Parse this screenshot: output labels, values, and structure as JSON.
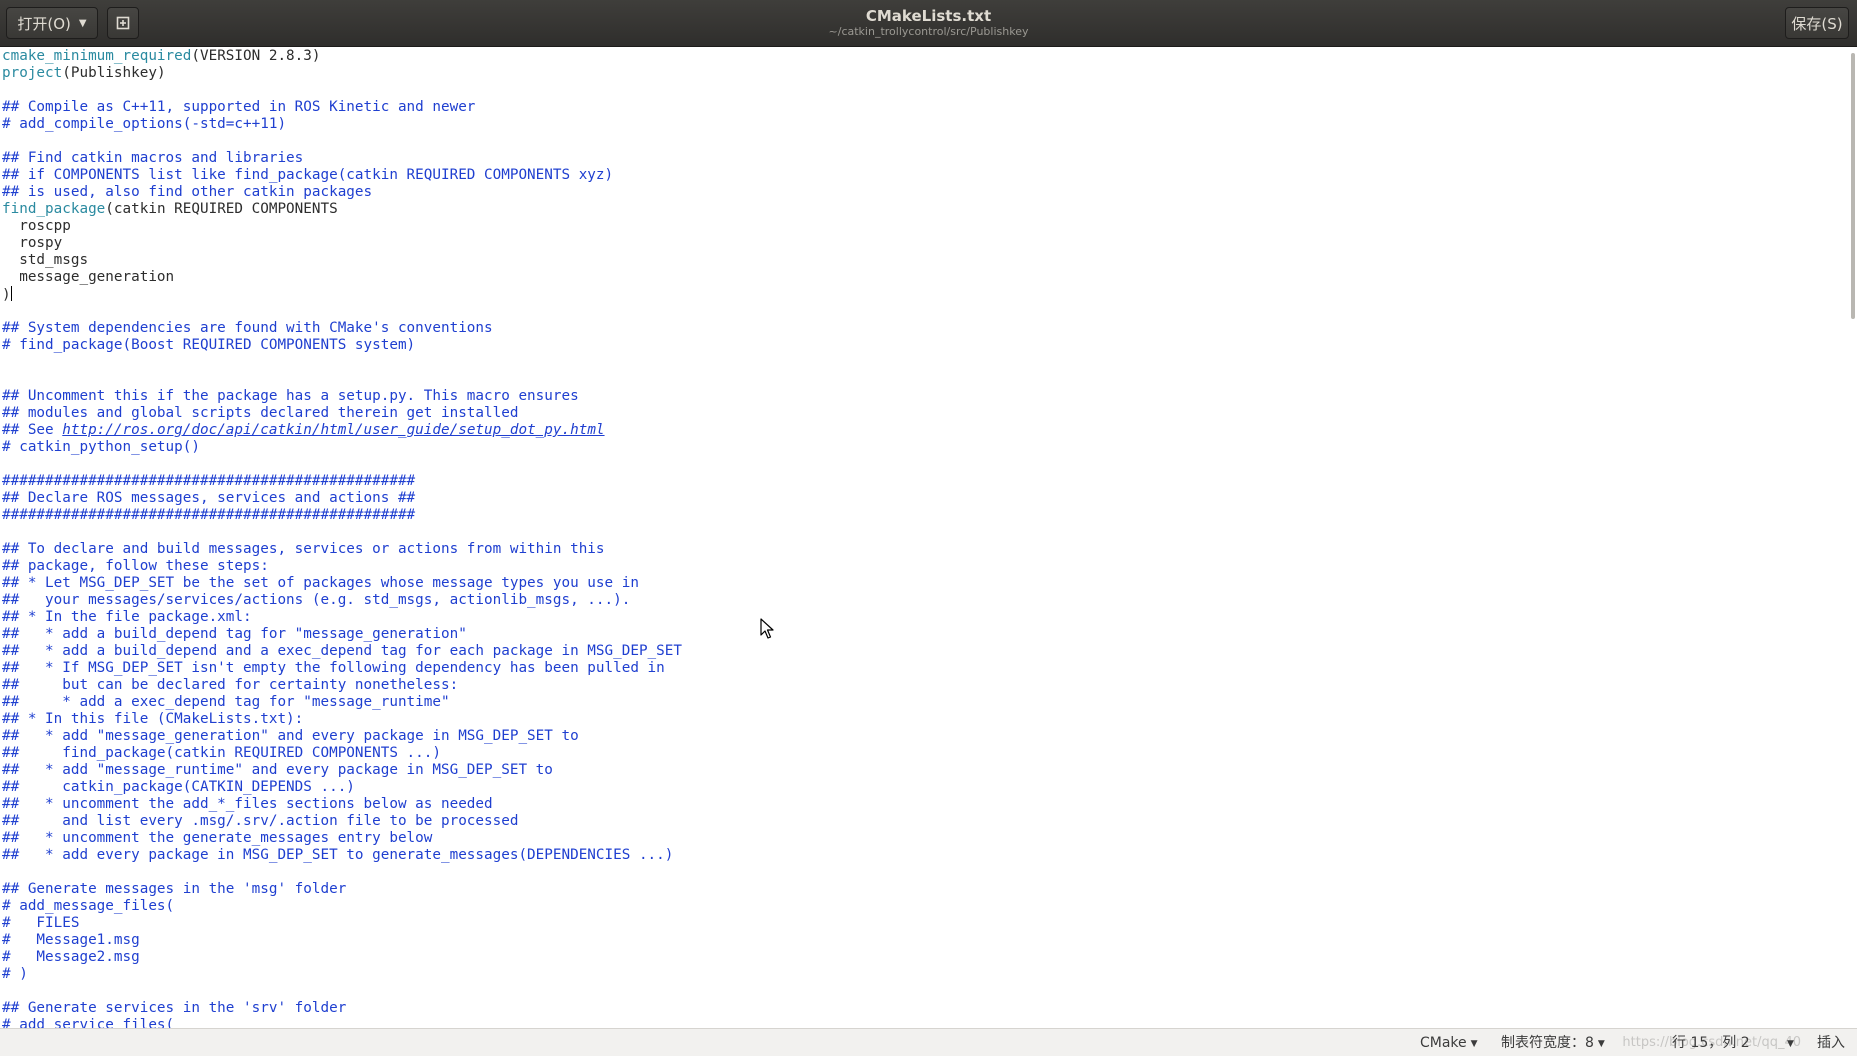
{
  "header": {
    "open_label": "打开(O)",
    "title": "CMakeLists.txt",
    "subtitle": "~/catkin_trollycontrol/src/Publishkey",
    "save_label": "保存(S)",
    "open_dropdown_icon": "chevron-down-icon",
    "bookmark_icon": "new-document-pin-icon"
  },
  "colors": {
    "comment": "#1f3fd0",
    "function": "#2a8aa0",
    "text": "#2d2d2d",
    "headerbar": "#353432"
  },
  "editor": {
    "lines": [
      [
        {
          "t": "cmake_minimum_required",
          "s": "func"
        },
        {
          "t": "(VERSION 2.8.3)",
          "s": "plain"
        }
      ],
      [
        {
          "t": "project",
          "s": "func"
        },
        {
          "t": "(Publishkey)",
          "s": "plain"
        }
      ],
      [],
      [
        {
          "t": "## Compile as C++11, supported in ROS Kinetic and newer",
          "s": "comment"
        }
      ],
      [
        {
          "t": "# add_compile_options(-std=c++11)",
          "s": "comment"
        }
      ],
      [],
      [
        {
          "t": "## Find catkin macros and libraries",
          "s": "comment"
        }
      ],
      [
        {
          "t": "## if COMPONENTS list like find_package(catkin REQUIRED COMPONENTS xyz)",
          "s": "comment"
        }
      ],
      [
        {
          "t": "## is used, also find other catkin packages",
          "s": "comment"
        }
      ],
      [
        {
          "t": "find_package",
          "s": "func"
        },
        {
          "t": "(catkin REQUIRED COMPONENTS",
          "s": "plain"
        }
      ],
      [
        {
          "t": "  roscpp",
          "s": "plain"
        }
      ],
      [
        {
          "t": "  rospy",
          "s": "plain"
        }
      ],
      [
        {
          "t": "  std_msgs",
          "s": "plain"
        }
      ],
      [
        {
          "t": "  message_generation",
          "s": "plain"
        }
      ],
      [
        {
          "t": ")",
          "s": "plain"
        },
        {
          "t": "",
          "s": "caret"
        }
      ],
      [],
      [
        {
          "t": "## System dependencies are found with CMake's conventions",
          "s": "comment"
        }
      ],
      [
        {
          "t": "# find_package(Boost REQUIRED COMPONENTS system)",
          "s": "comment"
        }
      ],
      [],
      [],
      [
        {
          "t": "## Uncomment this if the package has a setup.py. This macro ensures",
          "s": "comment"
        }
      ],
      [
        {
          "t": "## modules and global scripts declared therein get installed",
          "s": "comment"
        }
      ],
      [
        {
          "t": "## See ",
          "s": "comment"
        },
        {
          "t": "http://ros.org/doc/api/catkin/html/user_guide/setup_dot_py.html",
          "s": "link"
        }
      ],
      [
        {
          "t": "# catkin_python_setup()",
          "s": "comment"
        }
      ],
      [],
      [
        {
          "t": "################################################",
          "s": "comment"
        }
      ],
      [
        {
          "t": "## Declare ROS messages, services and actions ##",
          "s": "comment"
        }
      ],
      [
        {
          "t": "################################################",
          "s": "comment"
        }
      ],
      [],
      [
        {
          "t": "## To declare and build messages, services or actions from within this",
          "s": "comment"
        }
      ],
      [
        {
          "t": "## package, follow these steps:",
          "s": "comment"
        }
      ],
      [
        {
          "t": "## * Let MSG_DEP_SET be the set of packages whose message types you use in",
          "s": "comment"
        }
      ],
      [
        {
          "t": "##   your messages/services/actions (e.g. std_msgs, actionlib_msgs, ...).",
          "s": "comment"
        }
      ],
      [
        {
          "t": "## * In the file package.xml:",
          "s": "comment"
        }
      ],
      [
        {
          "t": "##   * add a build_depend tag for \"message_generation\"",
          "s": "comment"
        }
      ],
      [
        {
          "t": "##   * add a build_depend and a exec_depend tag for each package in MSG_DEP_SET",
          "s": "comment"
        }
      ],
      [
        {
          "t": "##   * If MSG_DEP_SET isn't empty the following dependency has been pulled in",
          "s": "comment"
        }
      ],
      [
        {
          "t": "##     but can be declared for certainty nonetheless:",
          "s": "comment"
        }
      ],
      [
        {
          "t": "##     * add a exec_depend tag for \"message_runtime\"",
          "s": "comment"
        }
      ],
      [
        {
          "t": "## * In this file (CMakeLists.txt):",
          "s": "comment"
        }
      ],
      [
        {
          "t": "##   * add \"message_generation\" and every package in MSG_DEP_SET to",
          "s": "comment"
        }
      ],
      [
        {
          "t": "##     find_package(catkin REQUIRED COMPONENTS ...)",
          "s": "comment"
        }
      ],
      [
        {
          "t": "##   * add \"message_runtime\" and every package in MSG_DEP_SET to",
          "s": "comment"
        }
      ],
      [
        {
          "t": "##     catkin_package(CATKIN_DEPENDS ...)",
          "s": "comment"
        }
      ],
      [
        {
          "t": "##   * uncomment the add_*_files sections below as needed",
          "s": "comment"
        }
      ],
      [
        {
          "t": "##     and list every .msg/.srv/.action file to be processed",
          "s": "comment"
        }
      ],
      [
        {
          "t": "##   * uncomment the generate_messages entry below",
          "s": "comment"
        }
      ],
      [
        {
          "t": "##   * add every package in MSG_DEP_SET to generate_messages(DEPENDENCIES ...)",
          "s": "comment"
        }
      ],
      [],
      [
        {
          "t": "## Generate messages in the 'msg' folder",
          "s": "comment"
        }
      ],
      [
        {
          "t": "# add_message_files(",
          "s": "comment"
        }
      ],
      [
        {
          "t": "#   FILES",
          "s": "comment"
        }
      ],
      [
        {
          "t": "#   Message1.msg",
          "s": "comment"
        }
      ],
      [
        {
          "t": "#   Message2.msg",
          "s": "comment"
        }
      ],
      [
        {
          "t": "# )",
          "s": "comment"
        }
      ],
      [],
      [
        {
          "t": "## Generate services in the 'srv' folder",
          "s": "comment"
        }
      ],
      [
        {
          "t": "# add_service_files(",
          "s": "comment"
        }
      ]
    ]
  },
  "status": {
    "language": "CMake",
    "tab_width": "制表符宽度：8",
    "position": "行 15，列 2",
    "mode": "插入",
    "watermark": "https://blog.csdn.net/qq_40"
  }
}
